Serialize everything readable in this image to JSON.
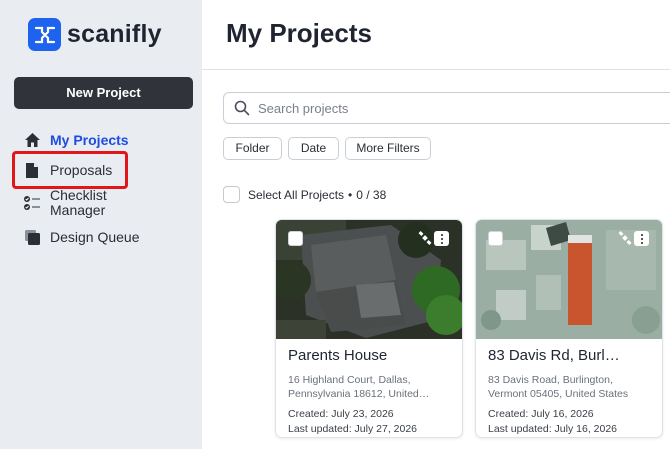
{
  "app": {
    "brand": "scanifly",
    "accent": "#1e63f0"
  },
  "sidebar": {
    "new_project_label": "New Project",
    "items": [
      {
        "label": "My Projects",
        "icon": "home-icon",
        "active": true
      },
      {
        "label": "Proposals",
        "icon": "document-icon",
        "highlighted": true
      },
      {
        "label_line1": "Checklist",
        "label_line2": "Manager",
        "icon": "checklist-icon"
      },
      {
        "label": "Design Queue",
        "icon": "stack-icon"
      }
    ]
  },
  "main": {
    "title": "My Projects",
    "search": {
      "placeholder": "Search projects"
    },
    "filters": [
      "Folder",
      "Date",
      "More Filters"
    ],
    "select_all": {
      "label": "Select All Projects",
      "count_text": "0 / 38"
    }
  },
  "projects": [
    {
      "title": "Parents House",
      "address_line1": "16 Highland Court, Dallas,",
      "address_line2": "Pennsylvania 18612, United…",
      "created": "Created: July 23, 2026",
      "updated": "Last updated: July 27, 2026"
    },
    {
      "title": "83 Davis Rd, Burl…",
      "address_line1": "83 Davis Road, Burlington,",
      "address_line2": "Vermont 05405, United States",
      "created": "Created: July 16, 2026",
      "updated": "Last updated: July 16, 2026"
    }
  ],
  "colors": {
    "highlight_border": "#e0161b",
    "active_nav": "#1e4ce0",
    "button_dark": "#30343a"
  }
}
